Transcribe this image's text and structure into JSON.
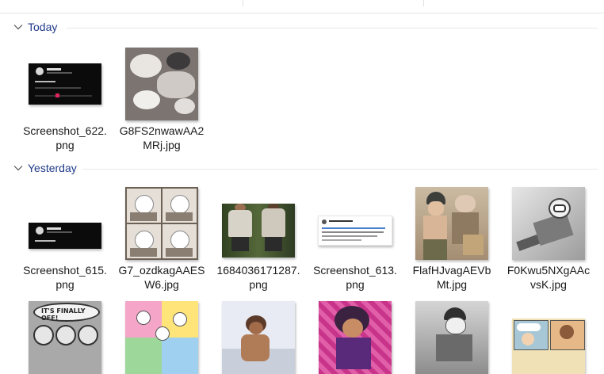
{
  "groups": {
    "today": {
      "label": "Today"
    },
    "yesterday": {
      "label": "Yesterday"
    }
  },
  "files": {
    "today": [
      {
        "name": "Screenshot_622.png"
      },
      {
        "name": "G8FS2nwawAA2MRj.jpg"
      }
    ],
    "yesterday": [
      {
        "name": "Screenshot_615.png"
      },
      {
        "name": "G7_ozdkagAAESW6.jpg"
      },
      {
        "name": "1684036171287.png"
      },
      {
        "name": "Screenshot_613.png"
      },
      {
        "name": "FlafHJvagAEVbMt.jpg"
      },
      {
        "name": "F0Kwu5NXgAAcvsK.jpg"
      }
    ],
    "yesterday_row2": [
      {
        "thumb_text": "IT'S FINALLY OFF!"
      },
      {},
      {},
      {},
      {},
      {}
    ]
  },
  "colors": {
    "group_label": "#1f3a8a",
    "divider": "#e8e8e8"
  }
}
